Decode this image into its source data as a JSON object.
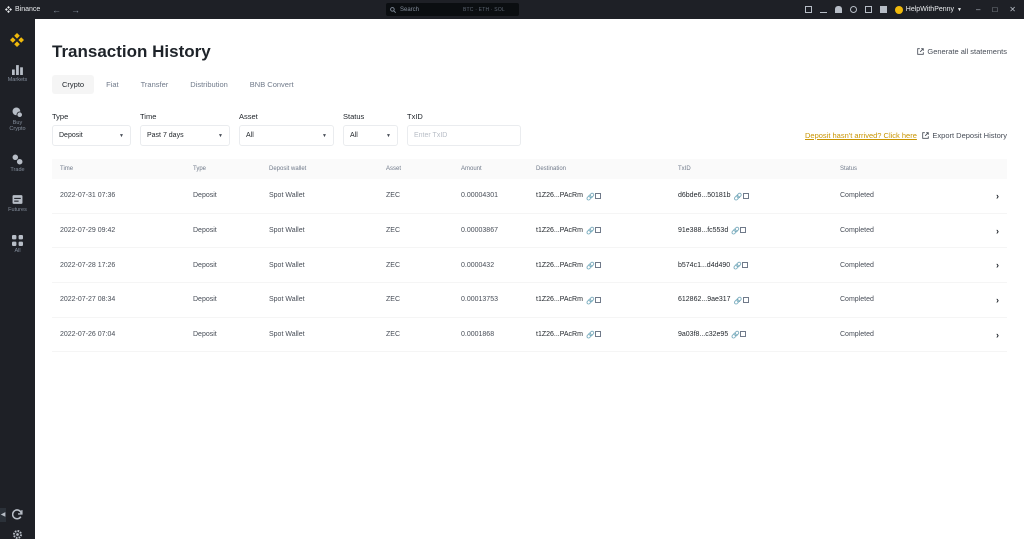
{
  "titlebar": {
    "app_name": "Binance",
    "search_placeholder": "Search",
    "search_hint": "BTC · ETH · SOL",
    "username": "HelpWithPenny"
  },
  "sidebar": {
    "items": [
      {
        "label": "Markets",
        "icon": "bar-chart-icon"
      },
      {
        "label": "Buy Crypto",
        "icon": "buy-crypto-icon"
      },
      {
        "label": "Trade",
        "icon": "trade-icon"
      },
      {
        "label": "Futures",
        "icon": "futures-icon"
      },
      {
        "label": "All",
        "icon": "grid-icon"
      }
    ]
  },
  "page": {
    "title": "Transaction History",
    "generate_statements": "Generate all statements",
    "tabs": [
      "Crypto",
      "Fiat",
      "Transfer",
      "Distribution",
      "BNB Convert"
    ],
    "active_tab": "Crypto"
  },
  "filters": {
    "type": {
      "label": "Type",
      "value": "Deposit"
    },
    "time": {
      "label": "Time",
      "value": "Past 7 days"
    },
    "asset": {
      "label": "Asset",
      "value": "All"
    },
    "status": {
      "label": "Status",
      "value": "All"
    },
    "txid": {
      "label": "TxID",
      "placeholder": "Enter TxID"
    }
  },
  "deposit_link": "Deposit hasn't arrived? Click here",
  "export_label": "Export Deposit History",
  "table": {
    "headers": [
      "Time",
      "Type",
      "Deposit wallet",
      "Asset",
      "Amount",
      "Destination",
      "TxID",
      "Status"
    ],
    "rows": [
      {
        "time": "2022-07-31 07:36",
        "type": "Deposit",
        "wallet": "Spot Wallet",
        "asset": "ZEC",
        "amount": "0.00004301",
        "destination": "t1Z26...PAcRm",
        "txid": "d6bde6...50181b",
        "status": "Completed"
      },
      {
        "time": "2022-07-29 09:42",
        "type": "Deposit",
        "wallet": "Spot Wallet",
        "asset": "ZEC",
        "amount": "0.00003867",
        "destination": "t1Z26...PAcRm",
        "txid": "91e388...fc553d",
        "status": "Completed"
      },
      {
        "time": "2022-07-28 17:26",
        "type": "Deposit",
        "wallet": "Spot Wallet",
        "asset": "ZEC",
        "amount": "0.0000432",
        "destination": "t1Z26...PAcRm",
        "txid": "b574c1...d4d490",
        "status": "Completed"
      },
      {
        "time": "2022-07-27 08:34",
        "type": "Deposit",
        "wallet": "Spot Wallet",
        "asset": "ZEC",
        "amount": "0.00013753",
        "destination": "t1Z26...PAcRm",
        "txid": "612862...9ae317",
        "status": "Completed"
      },
      {
        "time": "2022-07-26 07:04",
        "type": "Deposit",
        "wallet": "Spot Wallet",
        "asset": "ZEC",
        "amount": "0.0001868",
        "destination": "t1Z26...PAcRm",
        "txid": "9a03f8...c32e95",
        "status": "Completed"
      }
    ]
  },
  "colors": {
    "brand": "#F0B90B",
    "link": "#C99400",
    "sidebar_bg": "#1E2026"
  }
}
